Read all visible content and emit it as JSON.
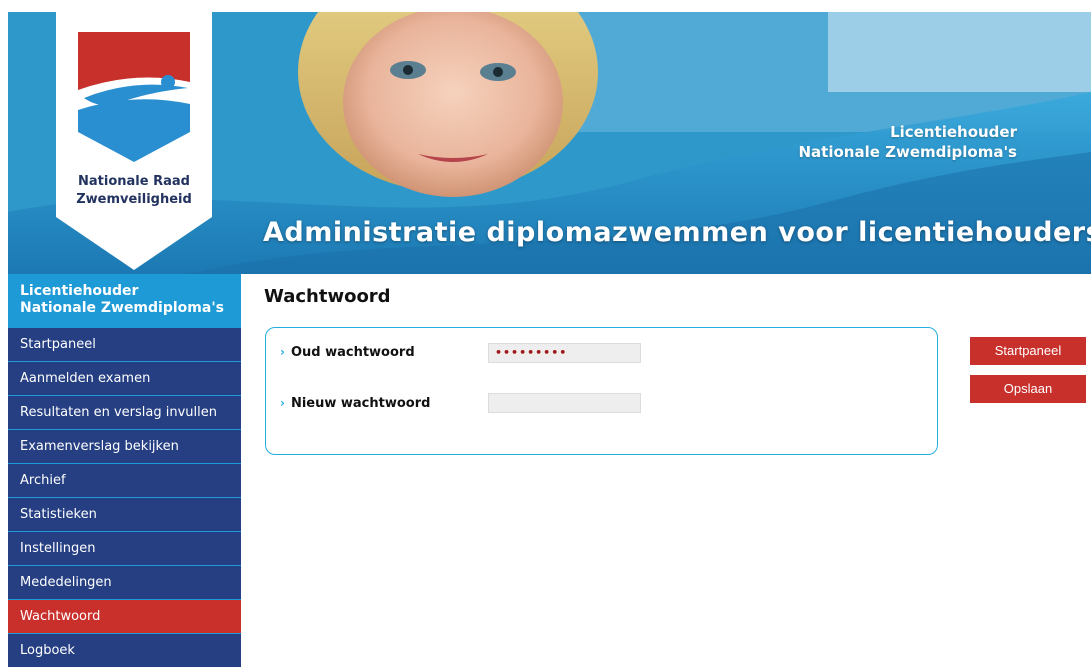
{
  "header": {
    "logo_line1": "Nationale Raad",
    "logo_line2": "Zwemveiligheid",
    "licence_line1": "Licentiehouder",
    "licence_line2": "Nationale Zwemdiploma's",
    "title": "Administratie diplomazwemmen voor licentiehouders"
  },
  "sidebar": {
    "header_line1": "Licentiehouder",
    "header_line2": "Nationale Zwemdiploma's",
    "items": [
      {
        "label": "Startpaneel"
      },
      {
        "label": "Aanmelden examen"
      },
      {
        "label": "Resultaten en verslag invullen"
      },
      {
        "label": "Examenverslag bekijken"
      },
      {
        "label": "Archief"
      },
      {
        "label": "Statistieken"
      },
      {
        "label": "Instellingen"
      },
      {
        "label": "Mededelingen"
      },
      {
        "label": "Wachtwoord"
      },
      {
        "label": "Logboek"
      }
    ],
    "active_index": 8
  },
  "main": {
    "title": "Wachtwoord",
    "fields": [
      {
        "label": "Oud wachtwoord",
        "value": "•••••••••",
        "caret": "›"
      },
      {
        "label": "Nieuw wachtwoord",
        "value": "",
        "caret": "›"
      }
    ]
  },
  "buttons": {
    "startpaneel": "Startpaneel",
    "opslaan": "Opslaan"
  },
  "colors": {
    "nav_bg": "#253f82",
    "nav_active": "#c9302c",
    "accent_blue": "#1e9ad6",
    "button_red": "#c8302c"
  }
}
